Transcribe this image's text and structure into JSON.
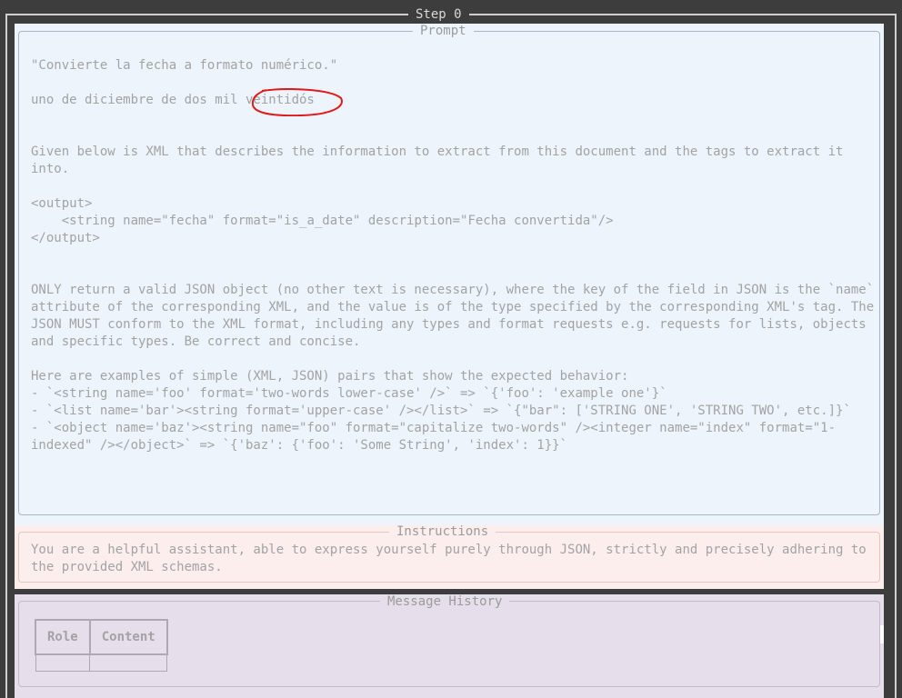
{
  "step": {
    "title": "Step 0"
  },
  "prompt": {
    "legend": "Prompt",
    "quote": "\"Convierte la fecha a formato numérico.\"",
    "date_text": "uno de diciembre de dos mil veintidós",
    "xml_intro": "Given below is XML that describes the information to extract from this document and the tags to extract it into.",
    "xml_code": "<output>\n    <string name=\"fecha\" format=\"is_a_date\" description=\"Fecha convertida\"/>\n</output>",
    "json_rule": "ONLY return a valid JSON object (no other text is necessary), where the key of the field in JSON is the `name` attribute of the corresponding XML, and the value is of the type specified by the corresponding XML's tag. The JSON MUST conform to the XML format, including any types and format requests e.g. requests for lists, objects and specific types. Be correct and concise.",
    "examples": "Here are examples of simple (XML, JSON) pairs that show the expected behavior:\n- `<string name='foo' format='two-words lower-case' />` => `{'foo': 'example one'}`\n- `<list name='bar'><string format='upper-case' /></list>` => `{\"bar\": ['STRING ONE', 'STRING TWO', etc.]}`\n- `<object name='baz'><string name=\"foo\" format=\"capitalize two-words\" /><integer name=\"index\" format=\"1-indexed\" /></object>` => `{'baz': {'foo': 'Some String', 'index': 1}}`"
  },
  "instructions": {
    "legend": "Instructions",
    "text": "You are a helpful assistant, able to express yourself purely through JSON, strictly and precisely adhering to the provided XML schemas."
  },
  "history": {
    "legend": "Message History",
    "columns": [
      "Role",
      "Content"
    ]
  },
  "colors": {
    "prompt_bg": "#edf4fc",
    "instructions_bg": "#fdeeee",
    "history_bg": "#e6deea",
    "annotation": "#e01b1b"
  }
}
